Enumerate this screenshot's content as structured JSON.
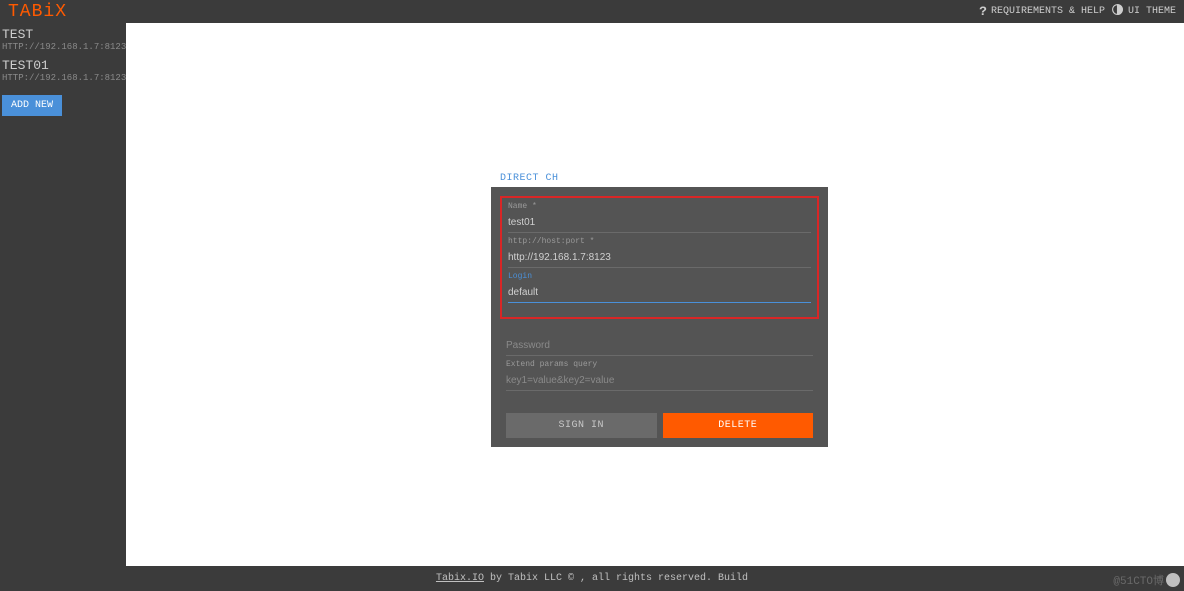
{
  "header": {
    "logo": "TABiX",
    "requirements_label": "REQUIREMENTS & HELP",
    "theme_label": "UI THEME"
  },
  "sidebar": {
    "connections": [
      {
        "name": "TEST",
        "url": "HTTP://192.168.1.7:8123"
      },
      {
        "name": "TEST01",
        "url": "HTTP://192.168.1.7:8123"
      }
    ],
    "add_new_label": "ADD NEW"
  },
  "form": {
    "tab_label": "DIRECT CH",
    "name_label": "Name *",
    "name_value": "test01",
    "host_label": "http://host:port *",
    "host_value": "http://192.168.1.7:8123",
    "login_label": "Login",
    "login_value": "default",
    "password_label": "Password",
    "password_value": "",
    "extend_label": "Extend params query",
    "extend_placeholder": "key1=value&key2=value",
    "extend_value": "",
    "signin_label": "SIGN IN",
    "delete_label": "DELETE"
  },
  "footer": {
    "link_text": "Tabix.IO",
    "rest_text": " by Tabix LLC © , all rights reserved. Build",
    "watermark": "@51CTO博"
  }
}
